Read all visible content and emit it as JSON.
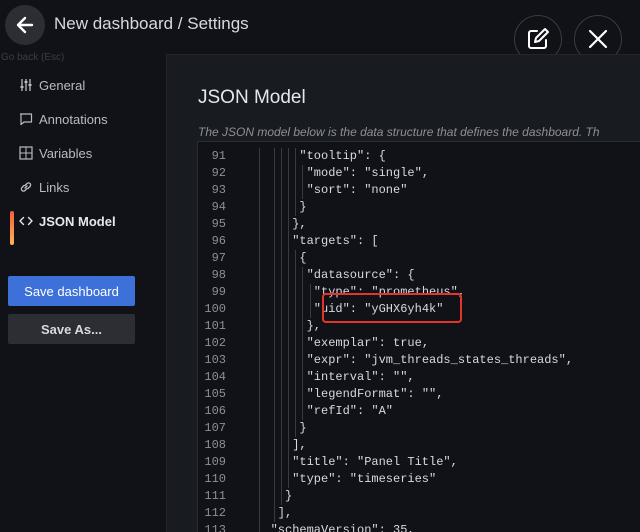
{
  "header": {
    "back_tooltip": "Go back (Esc)",
    "title": "New dashboard / Settings"
  },
  "sidebar": {
    "items": [
      {
        "label": "General",
        "icon": "sliders-icon"
      },
      {
        "label": "Annotations",
        "icon": "comment-icon"
      },
      {
        "label": "Variables",
        "icon": "calculator-icon"
      },
      {
        "label": "Links",
        "icon": "link-icon"
      },
      {
        "label": "JSON Model",
        "icon": "code-icon",
        "active": true
      }
    ],
    "save_label": "Save dashboard",
    "save_as_label": "Save As..."
  },
  "main": {
    "title": "JSON Model",
    "description": "The JSON model below is the data structure that defines the dashboard. Th"
  },
  "editor": {
    "lines": [
      {
        "n": "91",
        "text": "\"tooltip\": {"
      },
      {
        "n": "92",
        "text": "\"mode\": \"single\","
      },
      {
        "n": "93",
        "text": "\"sort\": \"none\""
      },
      {
        "n": "94",
        "text": "}"
      },
      {
        "n": "95",
        "text": "},"
      },
      {
        "n": "96",
        "text": "\"targets\": ["
      },
      {
        "n": "97",
        "text": "{"
      },
      {
        "n": "98",
        "text": "\"datasource\": {"
      },
      {
        "n": "99",
        "text": "\"type\": \"prometheus\","
      },
      {
        "n": "100",
        "text": "\"uid\": \"yGHX6yh4k\""
      },
      {
        "n": "101",
        "text": "},"
      },
      {
        "n": "102",
        "text": "\"exemplar\": true,"
      },
      {
        "n": "103",
        "text": "\"expr\": \"jvm_threads_states_threads\","
      },
      {
        "n": "104",
        "text": "\"interval\": \"\","
      },
      {
        "n": "105",
        "text": "\"legendFormat\": \"\","
      },
      {
        "n": "106",
        "text": "\"refId\": \"A\""
      },
      {
        "n": "107",
        "text": "}"
      },
      {
        "n": "108",
        "text": "],"
      },
      {
        "n": "109",
        "text": "\"title\": \"Panel Title\","
      },
      {
        "n": "110",
        "text": "\"type\": \"timeseries\""
      },
      {
        "n": "111",
        "text": "}"
      },
      {
        "n": "112",
        "text": "],"
      },
      {
        "n": "113",
        "text": "\"schemaVersion\": 35,"
      }
    ]
  },
  "colors": {
    "accent_primary": "#3d71d9",
    "highlight": "#e5352b",
    "active_gradient_top": "#f55f3e",
    "active_gradient_bottom": "#ffb357"
  }
}
